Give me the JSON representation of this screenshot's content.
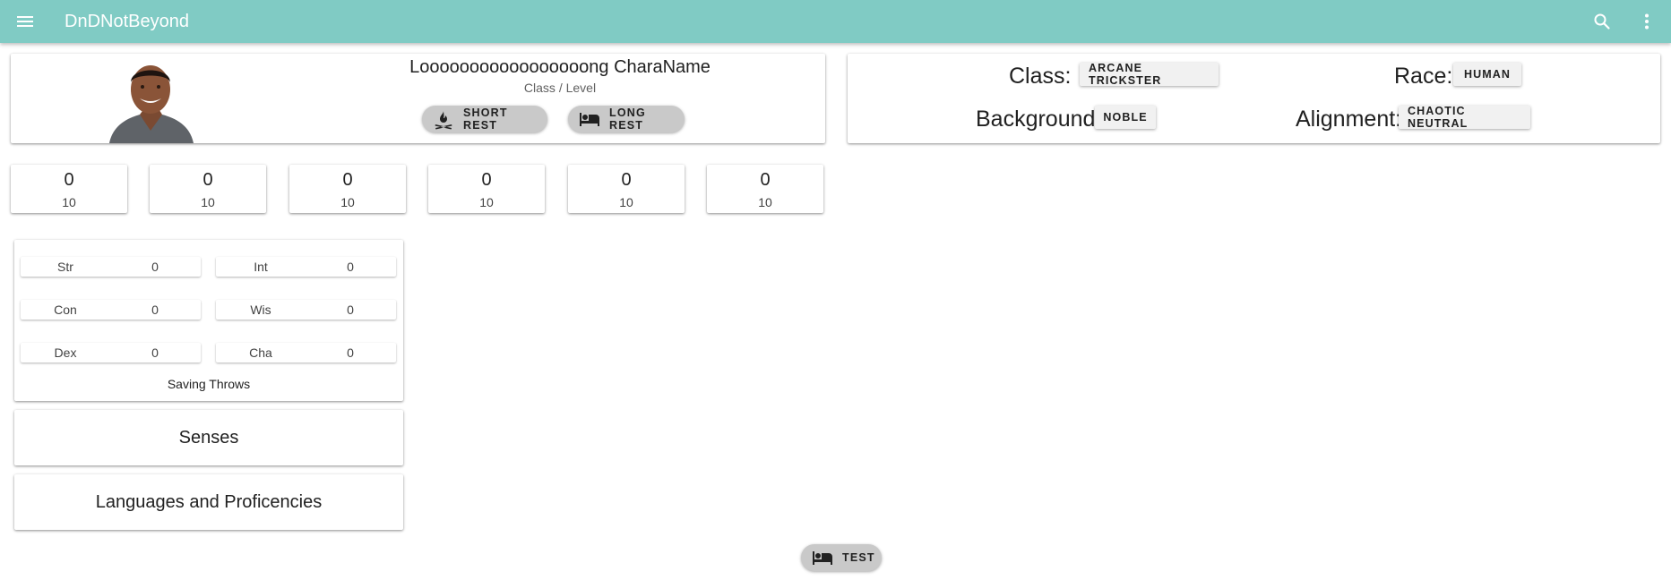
{
  "app": {
    "title": "DnDNotBeyond"
  },
  "colors": {
    "appbar": "#80cbc4",
    "button_bg": "#c9c9c9"
  },
  "icons": {
    "menu": "menu-icon",
    "search": "search-icon",
    "more": "more-vert-icon",
    "short_rest": "campfire-icon",
    "long_rest": "bed-icon"
  },
  "character": {
    "name": "Looooooooooooooooong CharaName",
    "subtitle": "Class / Level",
    "short_rest_label": "SHORT REST",
    "long_rest_label": "LONG REST"
  },
  "details": {
    "class_label": "Class:",
    "class_value": "ARCANE TRICKSTER",
    "race_label": "Race:",
    "race_value": "HUMAN",
    "background_label": "Background:",
    "background_value": "NOBLE",
    "alignment_label": "Alignment:",
    "alignment_value": "CHAOTIC NEUTRAL"
  },
  "abilities": [
    {
      "modifier": "0",
      "score": "10"
    },
    {
      "modifier": "0",
      "score": "10"
    },
    {
      "modifier": "0",
      "score": "10"
    },
    {
      "modifier": "0",
      "score": "10"
    },
    {
      "modifier": "0",
      "score": "10"
    },
    {
      "modifier": "0",
      "score": "10"
    }
  ],
  "saving_throws": {
    "caption": "Saving Throws",
    "items": [
      {
        "label": "Str",
        "value": "0"
      },
      {
        "label": "Int",
        "value": "0"
      },
      {
        "label": "Con",
        "value": "0"
      },
      {
        "label": "Wis",
        "value": "0"
      },
      {
        "label": "Dex",
        "value": "0"
      },
      {
        "label": "Cha",
        "value": "0"
      }
    ]
  },
  "sections": {
    "senses": "Senses",
    "languages": "Languages and Proficencies"
  },
  "test_button": {
    "label": "TEST"
  }
}
